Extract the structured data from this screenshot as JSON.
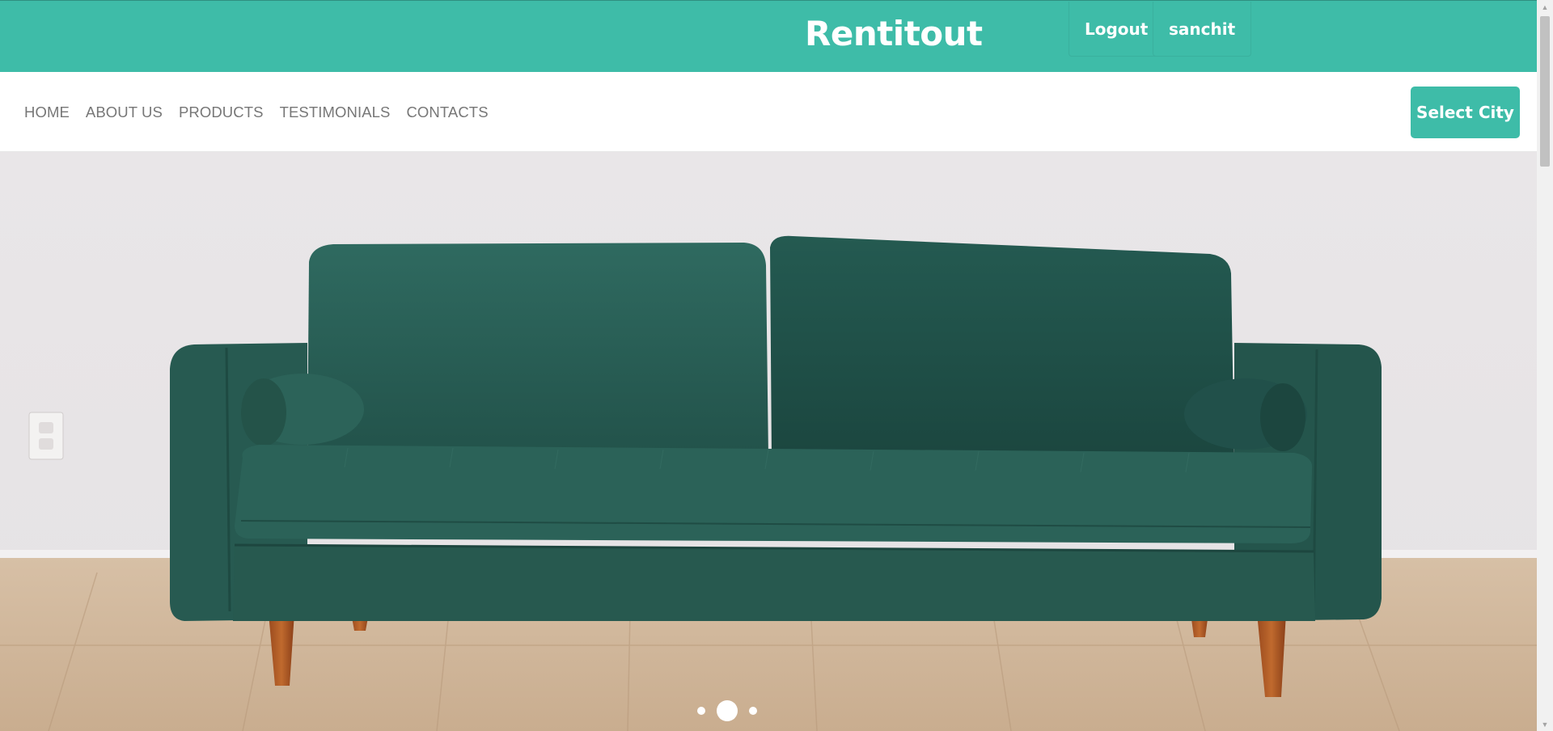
{
  "header": {
    "brand": "Rentitout",
    "logout_label": "Logout",
    "username": "sanchit"
  },
  "nav": {
    "links": [
      "HOME",
      "ABOUT US",
      "PRODUCTS",
      "TESTIMONIALS",
      "CONTACTS"
    ],
    "select_city_label": "Select City"
  },
  "hero": {
    "image": "green-velvet-sofa",
    "slide_count": 3,
    "active_slide": 2
  },
  "colors": {
    "brand": "#3ebca8",
    "nav_text": "#777777",
    "sofa": "#2a5e55"
  }
}
